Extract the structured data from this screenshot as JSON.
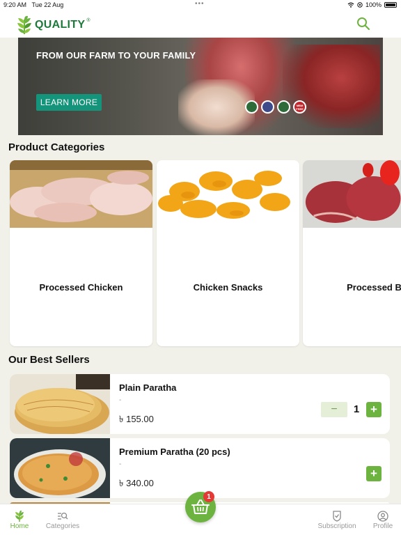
{
  "status": {
    "time": "9:20 AM",
    "date": "Tue 22 Aug",
    "battery": "100%",
    "battery_level": 1.0
  },
  "header": {
    "logo_text": "QUALITY",
    "logo_reg": "®",
    "search_icon": "search-icon"
  },
  "banner": {
    "title": "FROM OUR FARM TO YOUR FAMILY",
    "cta_label": "LEARN MORE",
    "badges": [
      "",
      "",
      "",
      "MBM FREE"
    ]
  },
  "categories": {
    "title": "Product Categories",
    "items": [
      {
        "label": "Processed Chicken"
      },
      {
        "label": "Chicken Snacks"
      },
      {
        "label": "Processed B"
      }
    ]
  },
  "best_sellers": {
    "title": "Our Best Sellers",
    "items": [
      {
        "name": "Plain Paratha",
        "subtitle": "-",
        "price": "৳ 155.00",
        "quantity": "1",
        "minus_label": "−",
        "plus_label": "+"
      },
      {
        "name": "Premium Paratha (20 pcs)",
        "subtitle": "-",
        "price": "৳ 340.00",
        "plus_label": "+"
      }
    ]
  },
  "cart": {
    "badge_count": "1"
  },
  "tabs": [
    {
      "label": "Home",
      "icon": "leaf-icon",
      "active": true
    },
    {
      "label": "Categories",
      "icon": "categories-search-icon",
      "active": false
    },
    {
      "label": "Subscription",
      "icon": "shield-check-icon",
      "active": false
    },
    {
      "label": "Profile",
      "icon": "user-circle-icon",
      "active": false
    }
  ],
  "colors": {
    "brand_green": "#6cb33f",
    "logo_green": "#1e7a3a",
    "cta_teal": "#14947a",
    "badge_red": "#e53935"
  }
}
